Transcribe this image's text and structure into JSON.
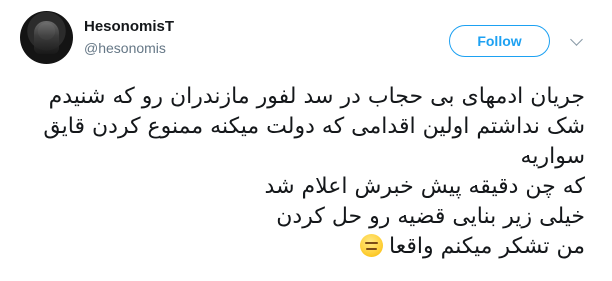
{
  "tweet": {
    "display_name": "HesonomisT",
    "username": "@hesonomis",
    "follow_label": "Follow",
    "icons": {
      "menu": "chevron-down-icon",
      "emoji": "expressionless-face-icon"
    },
    "colors": {
      "accent": "#1da1f2",
      "secondary_text": "#657786"
    },
    "text_lines": [
      "جریان ادمهای بی حجاب در سد لفور مازندران رو که شنیدم",
      "شک نداشتم اولین اقدامی که دولت میکنه ممنوع کردن قایق",
      "سواریه",
      "که چن دقیقه پیش خبرش اعلام شد",
      "خیلی زیر بنایی قضیه رو حل کردن",
      "من تشکر میکنم واقعا"
    ]
  }
}
